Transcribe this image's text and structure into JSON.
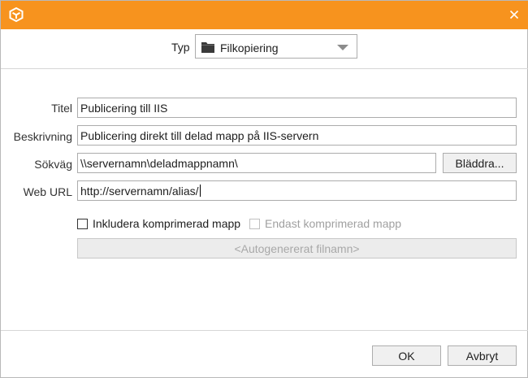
{
  "dialog": {
    "close_icon": "close-icon",
    "app_icon": "app-logo-icon",
    "accent_color": "#f7931e"
  },
  "type": {
    "label": "Typ",
    "value": "Filkopiering",
    "icon": "folder-icon"
  },
  "form": {
    "title_label": "Titel",
    "title_value": "Publicering till IIS",
    "description_label": "Beskrivning",
    "description_value": "Publicering direkt till delad mapp på IIS-servern",
    "path_label": "Sökväg",
    "path_value": "\\\\servernamn\\deladmappnamn\\",
    "browse_label": "Bläddra...",
    "url_label": "Web URL",
    "url_value": "http://servernamn/alias/"
  },
  "options": {
    "include_compressed_label": "Inkludera komprimerad mapp",
    "only_compressed_label": "Endast komprimerad mapp",
    "filename_placeholder": "<Autogenererat filnamn>"
  },
  "footer": {
    "ok_label": "OK",
    "cancel_label": "Avbryt"
  }
}
